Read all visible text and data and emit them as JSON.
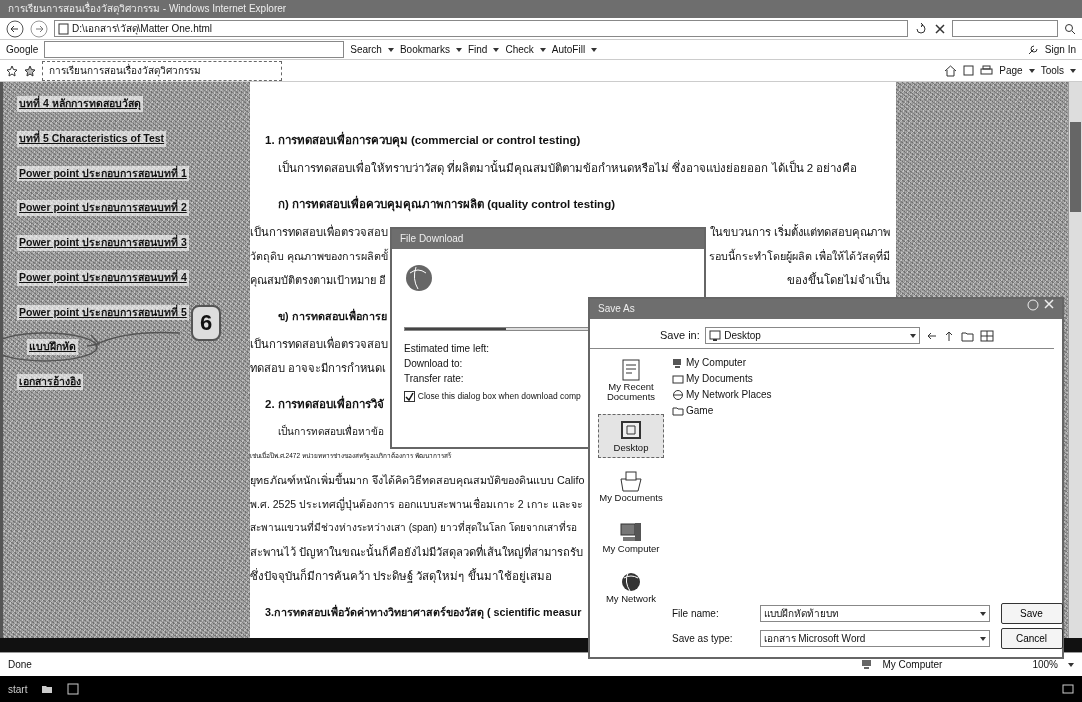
{
  "window": {
    "title": "การเรียนการสอนเรื่องวัสดุวิศวกรรม - Windows Internet Explorer"
  },
  "address_bar": {
    "url": "D:\\เอกสาร\\วัสดุ\\Matter One.html"
  },
  "google_toolbar": {
    "logo": "Google",
    "items": [
      {
        "label": "Search"
      },
      {
        "label": "Bookmarks"
      },
      {
        "label": "Find"
      },
      {
        "label": "Check"
      },
      {
        "label": "AutoFill"
      }
    ],
    "sign_in": "Sign In"
  },
  "tab": {
    "label": "การเรียนการสอนเรื่องวัสดุวิศวกรรม"
  },
  "command_bar": [
    "Page",
    "Tools"
  ],
  "sidebar": {
    "links": [
      {
        "label": "บทที่ 4 หลักการทดสอบวัสดุ",
        "circled": false
      },
      {
        "label": "บทที่ 5 Characteristics of Test",
        "circled": false
      },
      {
        "label": "Power point ประกอบการสอนบทที่ 1",
        "circled": false
      },
      {
        "label": "Power point ประกอบการสอนบทที่ 2",
        "circled": false
      },
      {
        "label": "Power point ประกอบการสอนบทที่ 3",
        "circled": false
      },
      {
        "label": "Power point ประกอบการสอนบทที่ 4",
        "circled": false
      },
      {
        "label": "Power point ประกอบการสอนบทที่ 5",
        "circled": false
      },
      {
        "label": "แบบฝึกหัด",
        "circled": true
      },
      {
        "label": "เอกสารอ้างอิง",
        "circled": false
      }
    ],
    "callout": "6"
  },
  "content": {
    "paragraphs": [
      {
        "kind": "heading",
        "lines": [
          {
            "left": "1.  การทดสอบเพื่อการควบคุม (commercial or control testing)"
          }
        ]
      },
      {
        "kind": "para",
        "lines": [
          {
            "left": "เป็นการทดสอบเพื่อให้ทราบว่าวัสดุ ที่ผลิตมานั้นมีคุณสมบัติตามข้อกำหนดหรือไม่ ซึ่งอาจแบ่งย่อยออก ได้เป็น 2 อย่างคือ"
          }
        ]
      },
      {
        "kind": "subheading",
        "lines": [
          {
            "left": "ก)  การทดสอบเพื่อควบคุมคุณภาพการผลิต (quality control testing)"
          }
        ]
      },
      {
        "kind": "flush",
        "lines": [
          {
            "left": "เป็นการทดสอบเพื่อตรวจสอบ",
            "right": "ในขบวนการ เริ่มตั้งแต่ทดสอบคุณภาพ"
          },
          {
            "left": "วัตถุดิบ คุณภาพของการผลิตขั้",
            "right": "รอบนี้กระทำโดยผู้ผลิต เพื่อให้ได้วัสดุที่มี"
          },
          {
            "left": "คุณสมบัติตรงตามเป้าหมาย อี",
            "right": "ของขึ้นโดยไม่จำเป็น"
          }
        ]
      },
      {
        "kind": "subheading",
        "lines": [
          {
            "left": "ข)  การทดสอบเพื่อการย"
          }
        ]
      },
      {
        "kind": "flush",
        "lines": [
          {
            "left": "เป็นการทดสอบเพื่อตรวจสอบ"
          },
          {
            "left": "ทดสอบ อาจจะมีการกำหนดเ"
          }
        ]
      },
      {
        "kind": "heading",
        "lines": [
          {
            "left": "2. การทดสอบเพื่อการวิจั"
          }
        ]
      },
      {
        "kind": "para",
        "lines": [
          {
            "left": "เป็นการทดสอบเพื่อหาข้อ"
          },
          {
            "left": "เช่นเมื่อปีพ.ศ.2472 หน่วยทหารช่างของสหรัฐอเมริกาต้องการ พัฒนาการสร้"
          },
          {
            "left": "ยุทธภัณฑ์หนักเพิ่มขึ้นมาก จึงได้คิดวิธีทดสอบคุณสมบัติของดินแบบ Califo"
          },
          {
            "left": "พ.ศ. 2525 ประเทศญี่ปุ่นต้องการ ออกแบบสะพานเชื่อมเกาะ 2 เกาะ และจะ"
          },
          {
            "left": "สะพานแขวนที่มีช่วงห่างระหว่างเสา (span) ยาวที่สุดในโลก โดยจากเสาที่รอ"
          },
          {
            "left": "สะพานไว้ ปัญหาในขณะนั้นก็คือยังไม่มีวัสดุลวดที่เส้นใหญ่ที่สามารถรับ"
          },
          {
            "left": "ซึ่งปัจจุบันก็มีการค้นคว้า ประดิษฐ์ วัสดุใหม่ๆ ขึ้นมาใช้อยู่เสมอ"
          }
        ]
      },
      {
        "kind": "heading",
        "lines": [
          {
            "left": "3.การทดสอบเพื่อวัดค่าทางวิทยาศาสตร์ของวัสดุ ( scientific measur"
          }
        ]
      }
    ]
  },
  "download_dialog": {
    "title": "File Download",
    "progress": {
      "level": 0.35
    },
    "fields": [
      "Estimated time left:",
      "Download to:",
      "Transfer rate:"
    ],
    "close_when_done": {
      "label": "Close this dialog box when download comp",
      "checked": true
    }
  },
  "save_as_dialog": {
    "title": "Save As",
    "save_in": {
      "label": "Save in:",
      "value": "Desktop"
    },
    "places": [
      {
        "label": "My Recent Documents",
        "selected": false,
        "kind": "recent"
      },
      {
        "label": "Desktop",
        "selected": true,
        "kind": "desktop"
      },
      {
        "label": "My Documents",
        "selected": false,
        "kind": "documents"
      },
      {
        "label": "My Computer",
        "selected": false,
        "kind": "computer"
      },
      {
        "label": "My Network",
        "selected": false,
        "kind": "network"
      }
    ],
    "files": [
      {
        "name": "My Computer",
        "kind": "computer"
      },
      {
        "name": "My Documents",
        "kind": "documents"
      },
      {
        "name": "My Network Places",
        "kind": "network"
      },
      {
        "name": "Game",
        "kind": "folder"
      }
    ],
    "file_name": {
      "label": "File name:",
      "value": "แบบฝึกหัดท้ายบท"
    },
    "save_as_type": {
      "label": "Save as type:",
      "value": "เอกสาร Microsoft Word"
    },
    "buttons": [
      "Save",
      "Cancel"
    ]
  },
  "status_bar": {
    "text": "Done",
    "zone": "My Computer",
    "zoom": "100%"
  },
  "taskbar": {
    "start": "start"
  }
}
